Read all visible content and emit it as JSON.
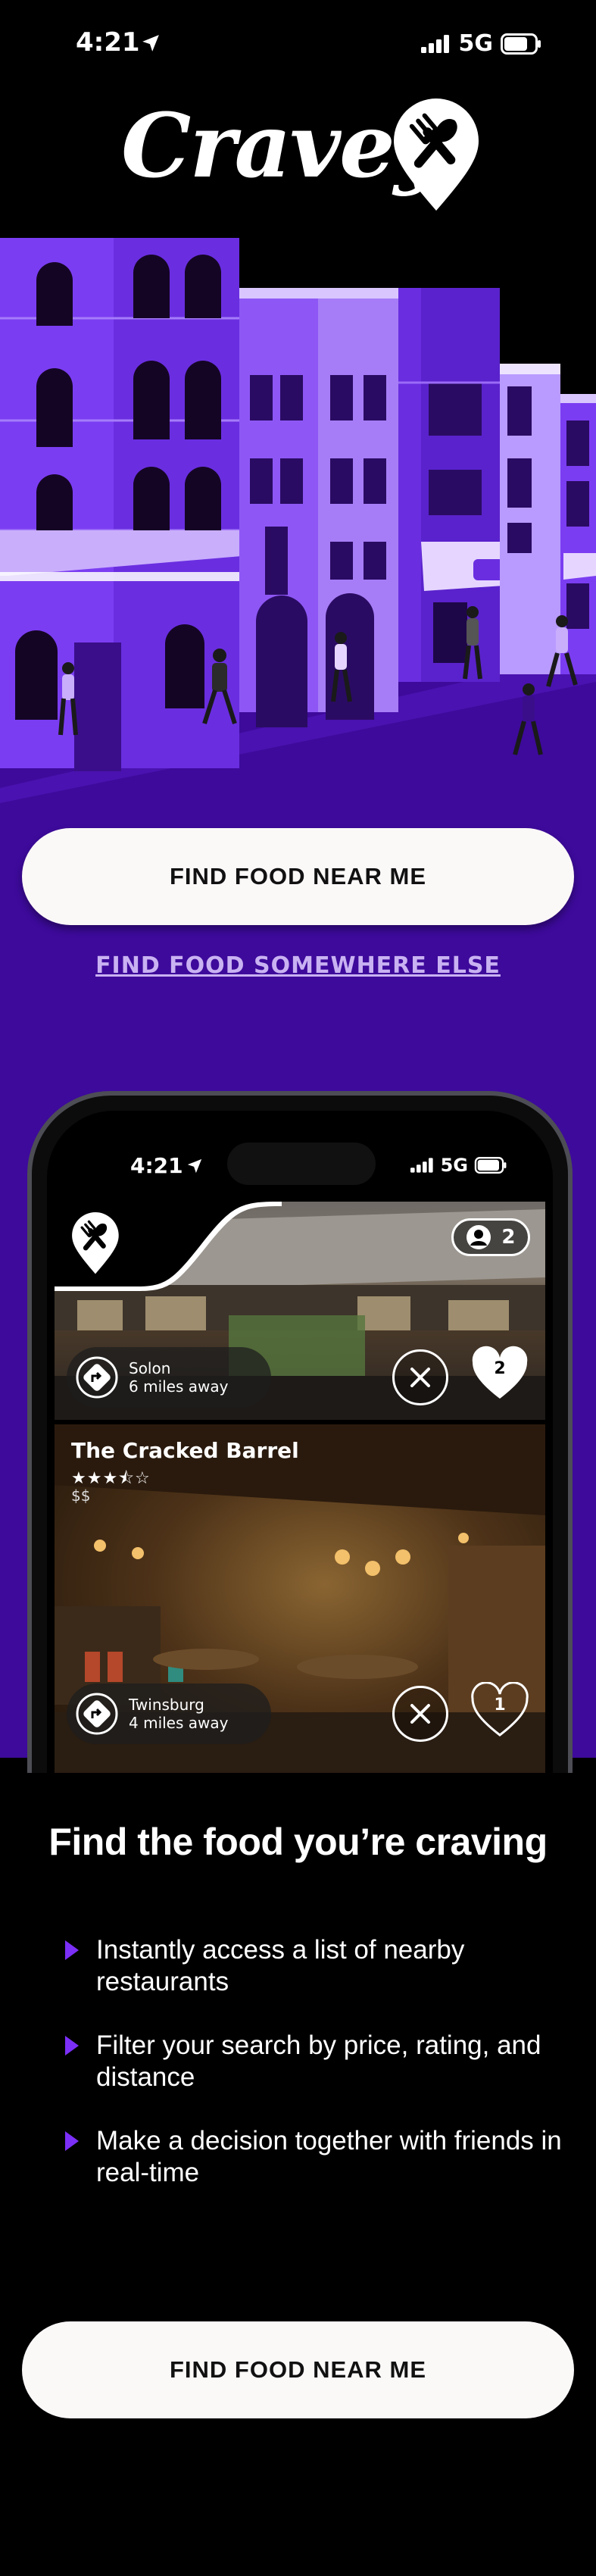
{
  "status_bar": {
    "time": "4:21",
    "network": "5G"
  },
  "header": {
    "logo_text": "Cravey"
  },
  "cta_primary_label": "FIND FOOD NEAR ME",
  "cta_secondary_label": "FIND FOOD SOMEWHERE ELSE",
  "phone": {
    "time": "4:21",
    "network": "5G",
    "people_count": "2",
    "cards": [
      {
        "location": "Solon",
        "distance": "6 miles away",
        "heart_count": "2"
      },
      {
        "name": "The Cracked Barrel",
        "stars": "★★★⯪☆",
        "price": "$$",
        "location": "Twinsburg",
        "distance": "4 miles away",
        "heart_count": "1"
      }
    ]
  },
  "features": {
    "title": "Find the food you’re craving",
    "items": [
      "Instantly access a list of nearby restaurants",
      "Filter your search by price, rating, and distance",
      "Make a decision together with friends in real-time"
    ]
  },
  "colors": {
    "purple": "#3d0a9b",
    "accent": "#7b2ff7",
    "button_bg": "#fbf8f8"
  }
}
